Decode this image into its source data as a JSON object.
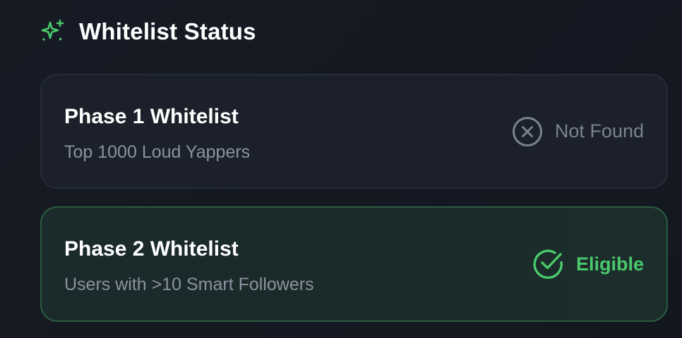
{
  "header": {
    "title": "Whitelist Status",
    "icon": "sparkles-icon"
  },
  "colors": {
    "accent_green": "#4ac96b",
    "muted_gray": "#7b8391",
    "background": "#151922"
  },
  "phases": [
    {
      "name": "Phase 1 Whitelist",
      "description": "Top 1000 Loud Yappers",
      "status": "Not Found",
      "status_icon": "x-circle-icon"
    },
    {
      "name": "Phase 2 Whitelist",
      "description": "Users with >10 Smart Followers",
      "status": "Eligible",
      "status_icon": "check-circle-icon"
    }
  ]
}
